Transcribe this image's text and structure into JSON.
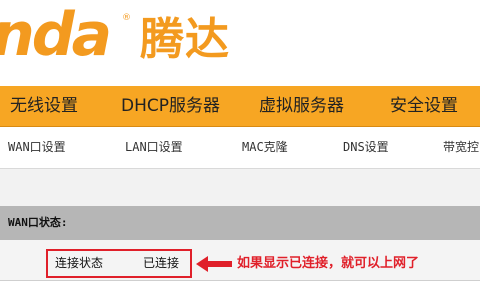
{
  "brand": {
    "logo_text": "nda",
    "registered_mark": "®",
    "chinese_name": "腾达",
    "color": "#f39a1f"
  },
  "main_nav": {
    "items": [
      {
        "label": "无线设置"
      },
      {
        "label": "DHCP服务器"
      },
      {
        "label": "虚拟服务器"
      },
      {
        "label": "安全设置"
      }
    ],
    "background": "#f7a623"
  },
  "sub_nav": {
    "items": [
      {
        "label": "WAN口设置"
      },
      {
        "label": "LAN口设置"
      },
      {
        "label": "MAC克隆"
      },
      {
        "label": "DNS设置"
      },
      {
        "label": "带宽控"
      }
    ]
  },
  "wan_status": {
    "title": "WAN口状态:",
    "status_label": "连接状态",
    "status_value": "已连接"
  },
  "annotation": {
    "text": "如果显示已连接，就可以上网了",
    "color": "#e0202a"
  }
}
